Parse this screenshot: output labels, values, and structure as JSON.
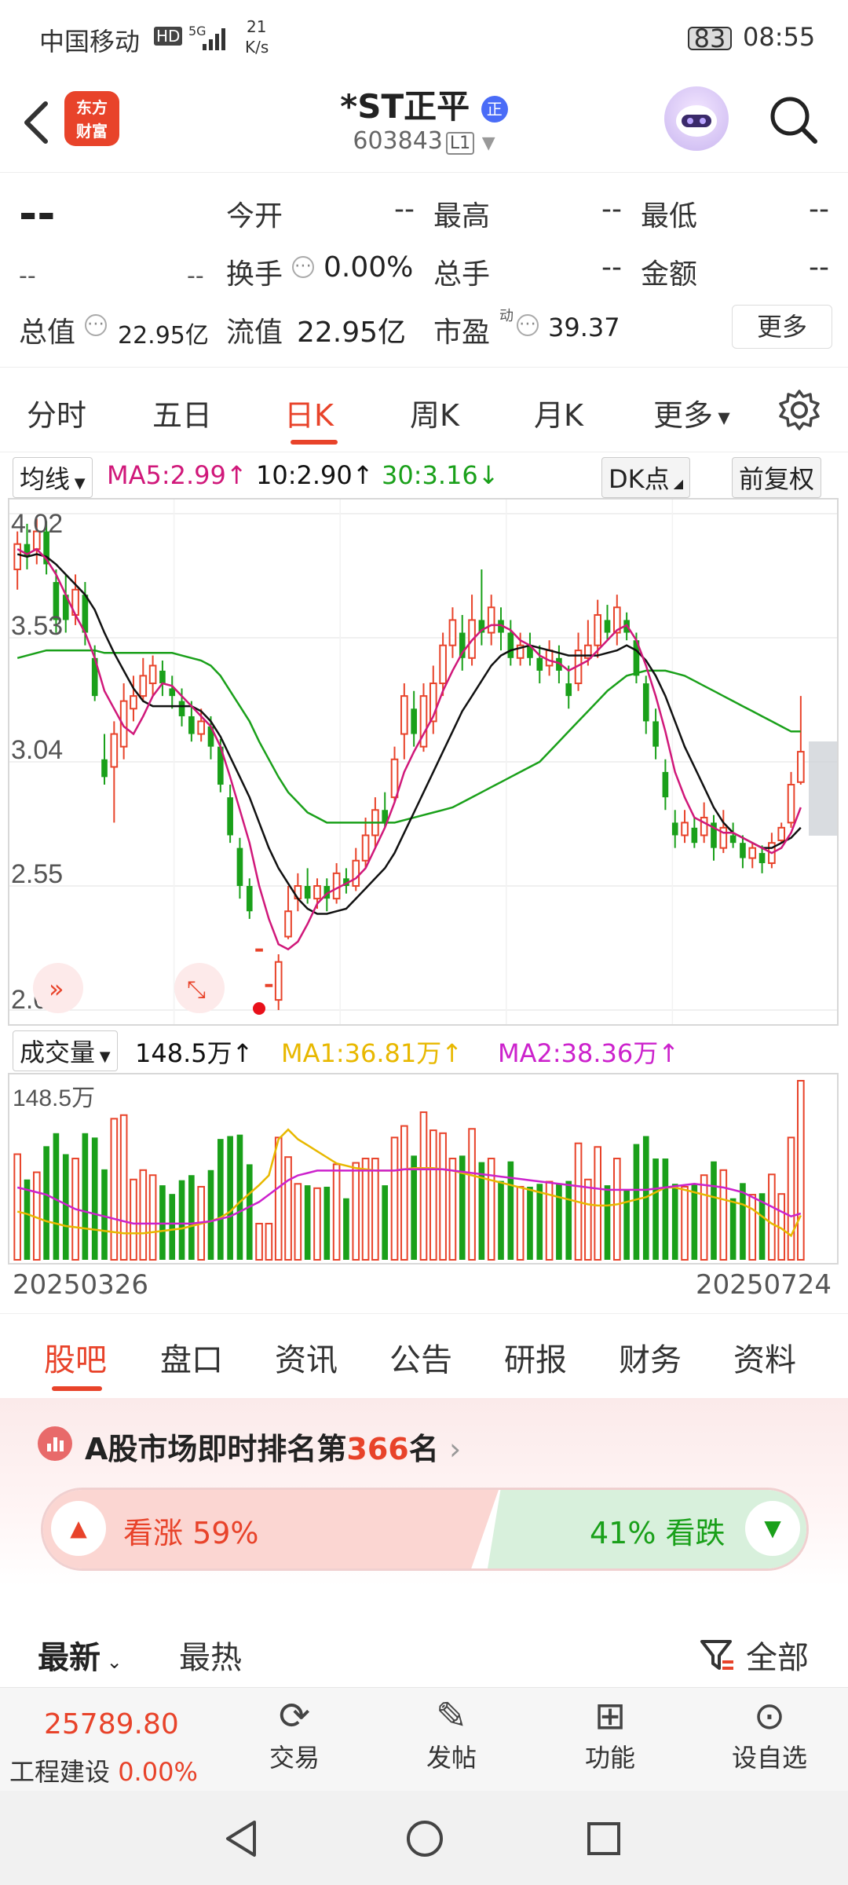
{
  "status_bar": {
    "carrier": "中国移动",
    "hd": "HD",
    "net": "5G",
    "speed_value": "21",
    "speed_unit": "K/s",
    "battery": "83",
    "time": "08:55"
  },
  "header": {
    "app_logo_line1": "东方",
    "app_logo_line2": "财富",
    "stock_name": "*ST正平",
    "name_badge": "正",
    "stock_code": "603843",
    "level_badge": "L1"
  },
  "quote": {
    "price": "--",
    "change": "--",
    "change_pct": "--",
    "open_label": "今开",
    "open_value": "--",
    "high_label": "最高",
    "high_value": "--",
    "low_label": "最低",
    "low_value": "--",
    "turnover_label": "换手",
    "turnover_value": "0.00%",
    "volume_label": "总手",
    "volume_value": "--",
    "amount_label": "金额",
    "amount_value": "--",
    "mktcap_label": "总值",
    "mktcap_value": "22.95亿",
    "float_label": "流值",
    "float_value": "22.95亿",
    "pe_label": "市盈",
    "pe_sup": "动",
    "pe_value": "39.37",
    "more_label": "更多"
  },
  "chart_tabs": [
    {
      "label": "分时"
    },
    {
      "label": "五日"
    },
    {
      "label": "日K"
    },
    {
      "label": "周K"
    },
    {
      "label": "月K"
    },
    {
      "label": "更多"
    }
  ],
  "active_chart_tab": "日K",
  "indicator_bar": {
    "ma_select": "均线",
    "ma5": "MA5:2.99",
    "ma10": "10:2.90",
    "ma30": "30:3.16",
    "dk_label": "DK点",
    "adjust_label": "前复权"
  },
  "volume_bar": {
    "select": "成交量",
    "vol": "148.5万",
    "ma1": "MA1:36.81万",
    "ma2": "MA2:38.36万",
    "axis_max": "148.5万"
  },
  "dates": {
    "start": "20250326",
    "end": "20250724"
  },
  "colors": {
    "up": "#e8432a",
    "down": "#1aa01a",
    "ma5": "#d0187a",
    "ma10": "#111111",
    "ma30": "#1aa01a",
    "vol_ma1": "#e8b800",
    "vol_ma2": "#cc22cc",
    "accent": "#e8432a"
  },
  "chart_data": {
    "type": "candlestick",
    "y_ticks": [
      "4.02",
      "3.53",
      "3.04",
      "2.55",
      "2.06"
    ],
    "ylim": [
      2.06,
      4.02
    ],
    "x_range": [
      "20250326",
      "20250724"
    ],
    "candles": [
      [
        3.8,
        3.9,
        3.95,
        3.72
      ],
      [
        3.9,
        3.85,
        3.98,
        3.8
      ],
      [
        3.88,
        3.95,
        4.0,
        3.82
      ],
      [
        3.95,
        3.82,
        3.99,
        3.78
      ],
      [
        3.75,
        3.6,
        3.8,
        3.55
      ],
      [
        3.7,
        3.6,
        3.78,
        3.55
      ],
      [
        3.62,
        3.72,
        3.78,
        3.58
      ],
      [
        3.7,
        3.55,
        3.75,
        3.5
      ],
      [
        3.45,
        3.3,
        3.5,
        3.28
      ],
      [
        3.05,
        2.98,
        3.15,
        2.95
      ],
      [
        3.02,
        3.15,
        3.2,
        2.8
      ],
      [
        3.1,
        3.28,
        3.35,
        3.05
      ],
      [
        3.25,
        3.3,
        3.38,
        3.2
      ],
      [
        3.3,
        3.38,
        3.45,
        3.28
      ],
      [
        3.35,
        3.42,
        3.46,
        3.3
      ],
      [
        3.4,
        3.35,
        3.44,
        3.3
      ],
      [
        3.33,
        3.3,
        3.38,
        3.25
      ],
      [
        3.28,
        3.22,
        3.33,
        3.18
      ],
      [
        3.22,
        3.15,
        3.28,
        3.12
      ],
      [
        3.15,
        3.2,
        3.25,
        3.12
      ],
      [
        3.18,
        3.1,
        3.22,
        3.05
      ],
      [
        3.1,
        2.95,
        3.13,
        2.92
      ],
      [
        2.9,
        2.75,
        2.95,
        2.72
      ],
      [
        2.7,
        2.55,
        2.74,
        2.5
      ],
      [
        2.55,
        2.45,
        2.58,
        2.42
      ],
      [
        2.3,
        2.3,
        2.3,
        2.3
      ],
      [
        2.16,
        2.16,
        2.16,
        2.16
      ],
      [
        2.1,
        2.25,
        2.28,
        2.06
      ],
      [
        2.35,
        2.45,
        2.55,
        2.34
      ],
      [
        2.5,
        2.55,
        2.6,
        2.45
      ],
      [
        2.55,
        2.5,
        2.62,
        2.48
      ],
      [
        2.5,
        2.55,
        2.58,
        2.46
      ],
      [
        2.55,
        2.5,
        2.58,
        2.45
      ],
      [
        2.5,
        2.6,
        2.64,
        2.48
      ],
      [
        2.58,
        2.55,
        2.62,
        2.52
      ],
      [
        2.55,
        2.65,
        2.7,
        2.53
      ],
      [
        2.65,
        2.75,
        2.82,
        2.62
      ],
      [
        2.75,
        2.85,
        2.9,
        2.7
      ],
      [
        2.85,
        2.8,
        2.92,
        2.78
      ],
      [
        2.9,
        3.05,
        3.1,
        2.88
      ],
      [
        3.15,
        3.3,
        3.35,
        3.05
      ],
      [
        3.25,
        3.15,
        3.32,
        3.1
      ],
      [
        3.1,
        3.3,
        3.35,
        3.08
      ],
      [
        3.2,
        3.35,
        3.42,
        3.15
      ],
      [
        3.35,
        3.5,
        3.55,
        3.3
      ],
      [
        3.5,
        3.6,
        3.65,
        3.45
      ],
      [
        3.55,
        3.45,
        3.62,
        3.4
      ],
      [
        3.45,
        3.6,
        3.7,
        3.42
      ],
      [
        3.6,
        3.55,
        3.8,
        3.5
      ],
      [
        3.55,
        3.65,
        3.7,
        3.5
      ],
      [
        3.6,
        3.55,
        3.65,
        3.48
      ],
      [
        3.55,
        3.45,
        3.6,
        3.42
      ],
      [
        3.45,
        3.5,
        3.55,
        3.42
      ],
      [
        3.5,
        3.45,
        3.55,
        3.42
      ],
      [
        3.45,
        3.4,
        3.5,
        3.35
      ],
      [
        3.42,
        3.48,
        3.52,
        3.38
      ],
      [
        3.45,
        3.4,
        3.5,
        3.35
      ],
      [
        3.35,
        3.3,
        3.42,
        3.25
      ],
      [
        3.35,
        3.48,
        3.55,
        3.32
      ],
      [
        3.45,
        3.5,
        3.6,
        3.42
      ],
      [
        3.5,
        3.62,
        3.68,
        3.45
      ],
      [
        3.6,
        3.55,
        3.66,
        3.52
      ],
      [
        3.55,
        3.65,
        3.7,
        3.5
      ],
      [
        3.6,
        3.55,
        3.63,
        3.52
      ],
      [
        3.52,
        3.38,
        3.55,
        3.35
      ],
      [
        3.35,
        3.2,
        3.38,
        3.15
      ],
      [
        3.2,
        3.1,
        3.25,
        3.05
      ],
      [
        3.0,
        2.9,
        3.05,
        2.85
      ],
      [
        2.8,
        2.75,
        2.85,
        2.7
      ],
      [
        2.75,
        2.8,
        2.85,
        2.72
      ],
      [
        2.78,
        2.72,
        2.82,
        2.7
      ],
      [
        2.75,
        2.82,
        2.88,
        2.72
      ],
      [
        2.8,
        2.7,
        2.83,
        2.65
      ],
      [
        2.7,
        2.78,
        2.85,
        2.68
      ],
      [
        2.75,
        2.72,
        2.8,
        2.7
      ],
      [
        2.72,
        2.66,
        2.75,
        2.62
      ],
      [
        2.66,
        2.7,
        2.72,
        2.62
      ],
      [
        2.68,
        2.64,
        2.71,
        2.6
      ],
      [
        2.64,
        2.72,
        2.76,
        2.62
      ],
      [
        2.73,
        2.78,
        2.8,
        2.72
      ],
      [
        2.8,
        2.95,
        3.0,
        2.78
      ],
      [
        2.96,
        3.08,
        3.3,
        2.95
      ]
    ],
    "ma5": [
      3.88,
      3.86,
      3.88,
      3.84,
      3.78,
      3.7,
      3.62,
      3.55,
      3.45,
      3.32,
      3.25,
      3.18,
      3.15,
      3.22,
      3.3,
      3.35,
      3.34,
      3.3,
      3.26,
      3.22,
      3.18,
      3.1,
      2.98,
      2.85,
      2.72,
      2.55,
      2.42,
      2.32,
      2.3,
      2.33,
      2.4,
      2.48,
      2.52,
      2.54,
      2.56,
      2.58,
      2.62,
      2.7,
      2.78,
      2.88,
      3.0,
      3.08,
      3.15,
      3.22,
      3.32,
      3.4,
      3.47,
      3.52,
      3.56,
      3.58,
      3.58,
      3.56,
      3.52,
      3.5,
      3.46,
      3.44,
      3.43,
      3.4,
      3.42,
      3.44,
      3.48,
      3.52,
      3.56,
      3.58,
      3.52,
      3.42,
      3.3,
      3.16,
      3.0,
      2.9,
      2.82,
      2.8,
      2.78,
      2.76,
      2.76,
      2.74,
      2.72,
      2.7,
      2.68,
      2.7,
      2.76,
      2.86
    ],
    "ma10": [
      3.86,
      3.85,
      3.86,
      3.85,
      3.82,
      3.78,
      3.74,
      3.7,
      3.64,
      3.55,
      3.47,
      3.4,
      3.33,
      3.28,
      3.26,
      3.26,
      3.26,
      3.26,
      3.26,
      3.24,
      3.2,
      3.14,
      3.06,
      2.98,
      2.9,
      2.8,
      2.7,
      2.62,
      2.56,
      2.5,
      2.46,
      2.44,
      2.44,
      2.45,
      2.46,
      2.5,
      2.54,
      2.58,
      2.62,
      2.68,
      2.76,
      2.84,
      2.92,
      3.0,
      3.08,
      3.16,
      3.24,
      3.3,
      3.36,
      3.42,
      3.46,
      3.48,
      3.49,
      3.5,
      3.49,
      3.48,
      3.47,
      3.46,
      3.46,
      3.46,
      3.46,
      3.47,
      3.48,
      3.5,
      3.48,
      3.44,
      3.38,
      3.3,
      3.2,
      3.1,
      3.02,
      2.94,
      2.86,
      2.8,
      2.76,
      2.74,
      2.72,
      2.7,
      2.7,
      2.72,
      2.74,
      2.78
    ],
    "ma30": [
      3.45,
      3.46,
      3.47,
      3.48,
      3.48,
      3.48,
      3.48,
      3.48,
      3.48,
      3.47,
      3.47,
      3.47,
      3.47,
      3.47,
      3.47,
      3.47,
      3.47,
      3.46,
      3.45,
      3.44,
      3.42,
      3.38,
      3.32,
      3.26,
      3.2,
      3.12,
      3.05,
      2.98,
      2.92,
      2.88,
      2.84,
      2.82,
      2.8,
      2.8,
      2.8,
      2.8,
      2.8,
      2.8,
      2.8,
      2.8,
      2.81,
      2.82,
      2.83,
      2.84,
      2.85,
      2.86,
      2.88,
      2.9,
      2.92,
      2.94,
      2.96,
      2.98,
      3.0,
      3.02,
      3.04,
      3.08,
      3.12,
      3.16,
      3.2,
      3.24,
      3.28,
      3.32,
      3.35,
      3.38,
      3.39,
      3.4,
      3.4,
      3.4,
      3.39,
      3.38,
      3.36,
      3.34,
      3.32,
      3.3,
      3.28,
      3.26,
      3.24,
      3.22,
      3.2,
      3.18,
      3.16,
      3.16
    ],
    "volume_ylim": [
      0,
      148.5
    ],
    "volume_ma1": [
      40,
      38,
      35,
      32,
      30,
      28,
      27,
      26,
      25,
      24,
      23,
      22,
      22,
      22,
      23,
      24,
      25,
      26,
      28,
      30,
      32,
      35,
      40,
      48,
      55,
      62,
      70,
      100,
      108,
      100,
      95,
      90,
      85,
      80,
      78,
      76,
      75,
      74,
      74,
      74,
      75,
      76,
      76,
      76,
      75,
      74,
      72,
      70,
      68,
      66,
      64,
      62,
      60,
      58,
      56,
      54,
      52,
      50,
      48,
      46,
      45,
      45,
      46,
      48,
      50,
      52,
      56,
      60,
      60,
      58,
      56,
      54,
      52,
      50,
      48,
      46,
      42,
      36,
      30,
      26,
      20,
      36.81
    ],
    "volume_ma2": [
      60,
      58,
      56,
      54,
      50,
      46,
      42,
      40,
      38,
      36,
      34,
      32,
      30,
      30,
      30,
      30,
      30,
      30,
      30,
      31,
      32,
      34,
      36,
      40,
      44,
      48,
      54,
      60,
      66,
      70,
      72,
      74,
      74,
      74,
      74,
      74,
      74,
      74,
      74,
      74,
      75,
      75,
      75,
      75,
      75,
      74,
      73,
      72,
      71,
      70,
      69,
      68,
      67,
      66,
      65,
      64,
      63,
      62,
      61,
      60,
      59,
      58,
      58,
      58,
      58,
      58,
      59,
      60,
      61,
      62,
      63,
      62,
      61,
      60,
      58,
      56,
      52,
      48,
      44,
      40,
      36,
      38.36
    ]
  }
}
